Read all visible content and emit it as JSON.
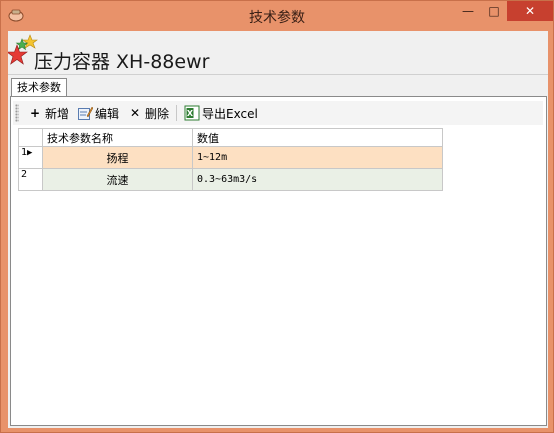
{
  "window": {
    "title": "技术参数",
    "minimize_label": "—",
    "maximize_label": "□",
    "close_label": "✕"
  },
  "header": {
    "title": "压力容器 XH-88ewr"
  },
  "tabs": [
    {
      "label": "技术参数"
    }
  ],
  "toolbar": {
    "add_label": "新增",
    "edit_label": "编辑",
    "delete_label": "删除",
    "export_label": "导出Excel"
  },
  "grid": {
    "columns": [
      "技术参数名称",
      "数值"
    ],
    "rows": [
      {
        "index": "1",
        "name": "扬程",
        "value": "1~12m"
      },
      {
        "index": "2",
        "name": "流速",
        "value": "0.3~63m3/s"
      }
    ]
  },
  "colors": {
    "titlebar": "#e8926a",
    "close_button": "#c7402f",
    "selected_row": "#fde0c2",
    "alt_row": "#eaf0e6"
  }
}
